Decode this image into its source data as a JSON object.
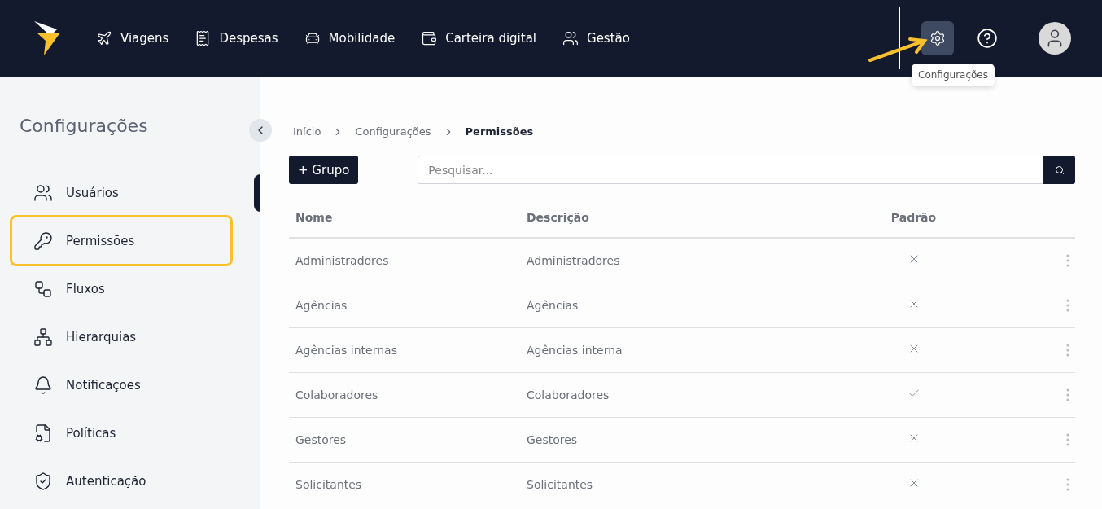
{
  "top_nav": {
    "items": [
      {
        "label": "Viagens",
        "kind": "plane"
      },
      {
        "label": "Despesas",
        "kind": "receipt"
      },
      {
        "label": "Mobilidade",
        "kind": "car"
      },
      {
        "label": "Carteira digital",
        "kind": "wallet"
      },
      {
        "label": "Gestão",
        "kind": "users"
      }
    ],
    "settings_tooltip": "Configurações"
  },
  "sidebar": {
    "title": "Configurações",
    "items": [
      {
        "label": "Usuários",
        "kind": "users",
        "selected": false
      },
      {
        "label": "Permissões",
        "kind": "key",
        "selected": true
      },
      {
        "label": "Fluxos",
        "kind": "flow",
        "selected": false
      },
      {
        "label": "Hierarquias",
        "kind": "tree",
        "selected": false
      },
      {
        "label": "Notificações",
        "kind": "bell",
        "selected": false
      },
      {
        "label": "Políticas",
        "kind": "policy",
        "selected": false
      },
      {
        "label": "Autenticação",
        "kind": "shield",
        "selected": false
      }
    ]
  },
  "breadcrumb": [
    "Início",
    "Configurações",
    "Permissões"
  ],
  "add_button": "+ Grupo",
  "search": {
    "placeholder": "Pesquisar..."
  },
  "table": {
    "columns": [
      "Nome",
      "Descrição",
      "Padrão"
    ],
    "rows": [
      {
        "name": "Administradores",
        "description": "Administradores",
        "default": false
      },
      {
        "name": "Agências",
        "description": "Agências",
        "default": false
      },
      {
        "name": "Agências internas",
        "description": "Agências interna",
        "default": false
      },
      {
        "name": "Colaboradores",
        "description": "Colaboradores",
        "default": true
      },
      {
        "name": "Gestores",
        "description": "Gestores",
        "default": false
      },
      {
        "name": "Solicitantes",
        "description": "Solicitantes",
        "default": false
      }
    ]
  }
}
